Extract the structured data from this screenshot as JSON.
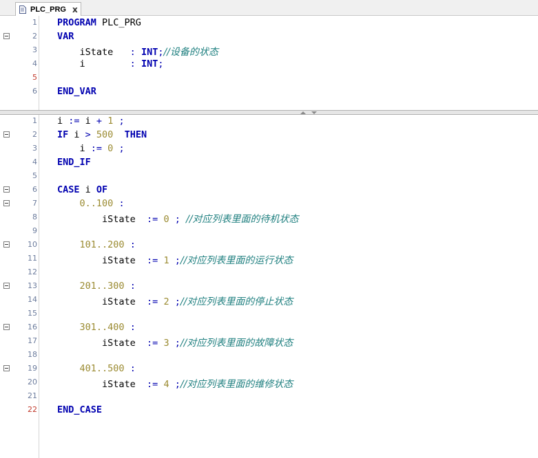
{
  "tab": {
    "title": "PLC_PRG",
    "close": "x",
    "icon": "document-icon"
  },
  "declaration": {
    "lines": [
      {
        "n": "1",
        "fold": false,
        "parts": [
          [
            "kw",
            "PROGRAM"
          ],
          [
            "t",
            " PLC_PRG"
          ]
        ]
      },
      {
        "n": "2",
        "fold": true,
        "parts": [
          [
            "kw",
            "VAR"
          ]
        ]
      },
      {
        "n": "3",
        "fold": false,
        "parts": [
          [
            "t",
            "    iState   "
          ],
          [
            "op",
            ": "
          ],
          [
            "kw",
            "INT"
          ],
          [
            "op",
            ";"
          ],
          [
            "cmt",
            "//设备的状态"
          ]
        ]
      },
      {
        "n": "4",
        "fold": false,
        "parts": [
          [
            "t",
            "    i        "
          ],
          [
            "op",
            ": "
          ],
          [
            "kw",
            "INT"
          ],
          [
            "op",
            ";"
          ]
        ]
      },
      {
        "n": "5",
        "fold": false,
        "err": true,
        "parts": []
      },
      {
        "n": "6",
        "fold": false,
        "parts": [
          [
            "kw",
            "END_VAR"
          ]
        ]
      }
    ]
  },
  "implementation": {
    "lines": [
      {
        "n": "1",
        "fold": false,
        "parts": [
          [
            "t",
            "i "
          ],
          [
            "op",
            ":= "
          ],
          [
            "t",
            "i "
          ],
          [
            "op",
            "+ "
          ],
          [
            "num",
            "1"
          ],
          [
            "t",
            " "
          ],
          [
            "op",
            ";"
          ]
        ]
      },
      {
        "n": "2",
        "fold": true,
        "parts": [
          [
            "kw",
            "IF"
          ],
          [
            "t",
            " i "
          ],
          [
            "op",
            "> "
          ],
          [
            "num",
            "500"
          ],
          [
            "t",
            "  "
          ],
          [
            "kw",
            "THEN"
          ]
        ]
      },
      {
        "n": "3",
        "fold": false,
        "parts": [
          [
            "t",
            "    i "
          ],
          [
            "op",
            ":= "
          ],
          [
            "num",
            "0"
          ],
          [
            "t",
            " "
          ],
          [
            "op",
            ";"
          ]
        ]
      },
      {
        "n": "4",
        "fold": false,
        "parts": [
          [
            "kw",
            "END_IF"
          ]
        ]
      },
      {
        "n": "5",
        "fold": false,
        "parts": []
      },
      {
        "n": "6",
        "fold": true,
        "parts": [
          [
            "kw",
            "CASE"
          ],
          [
            "t",
            " i "
          ],
          [
            "kw",
            "OF"
          ]
        ]
      },
      {
        "n": "7",
        "fold": true,
        "parts": [
          [
            "t",
            "    "
          ],
          [
            "num",
            "0..100"
          ],
          [
            "t",
            " "
          ],
          [
            "op",
            ":"
          ]
        ]
      },
      {
        "n": "8",
        "fold": false,
        "parts": [
          [
            "t",
            "        iState  "
          ],
          [
            "op",
            ":= "
          ],
          [
            "num",
            "0"
          ],
          [
            "t",
            " "
          ],
          [
            "op",
            "; "
          ],
          [
            "cmt",
            "//对应列表里面的待机状态"
          ]
        ]
      },
      {
        "n": "9",
        "fold": false,
        "parts": []
      },
      {
        "n": "10",
        "fold": true,
        "parts": [
          [
            "t",
            "    "
          ],
          [
            "num",
            "101..200"
          ],
          [
            "t",
            " "
          ],
          [
            "op",
            ":"
          ]
        ]
      },
      {
        "n": "11",
        "fold": false,
        "parts": [
          [
            "t",
            "        iState  "
          ],
          [
            "op",
            ":= "
          ],
          [
            "num",
            "1"
          ],
          [
            "t",
            " "
          ],
          [
            "op",
            ";"
          ],
          [
            "cmt",
            "//对应列表里面的运行状态"
          ]
        ]
      },
      {
        "n": "12",
        "fold": false,
        "parts": []
      },
      {
        "n": "13",
        "fold": true,
        "parts": [
          [
            "t",
            "    "
          ],
          [
            "num",
            "201..300"
          ],
          [
            "t",
            " "
          ],
          [
            "op",
            ":"
          ]
        ]
      },
      {
        "n": "14",
        "fold": false,
        "parts": [
          [
            "t",
            "        iState  "
          ],
          [
            "op",
            ":= "
          ],
          [
            "num",
            "2"
          ],
          [
            "t",
            " "
          ],
          [
            "op",
            ";"
          ],
          [
            "cmt",
            "//对应列表里面的停止状态"
          ]
        ]
      },
      {
        "n": "15",
        "fold": false,
        "parts": []
      },
      {
        "n": "16",
        "fold": true,
        "parts": [
          [
            "t",
            "    "
          ],
          [
            "num",
            "301..400"
          ],
          [
            "t",
            " "
          ],
          [
            "op",
            ":"
          ]
        ]
      },
      {
        "n": "17",
        "fold": false,
        "parts": [
          [
            "t",
            "        iState  "
          ],
          [
            "op",
            ":= "
          ],
          [
            "num",
            "3"
          ],
          [
            "t",
            " "
          ],
          [
            "op",
            ";"
          ],
          [
            "cmt",
            "//对应列表里面的故障状态"
          ]
        ]
      },
      {
        "n": "18",
        "fold": false,
        "parts": []
      },
      {
        "n": "19",
        "fold": true,
        "parts": [
          [
            "t",
            "    "
          ],
          [
            "num",
            "401..500"
          ],
          [
            "t",
            " "
          ],
          [
            "op",
            ":"
          ]
        ]
      },
      {
        "n": "20",
        "fold": false,
        "parts": [
          [
            "t",
            "        iState  "
          ],
          [
            "op",
            ":= "
          ],
          [
            "num",
            "4"
          ],
          [
            "t",
            " "
          ],
          [
            "op",
            ";"
          ],
          [
            "cmt",
            "//对应列表里面的维修状态"
          ]
        ]
      },
      {
        "n": "21",
        "fold": false,
        "parts": []
      },
      {
        "n": "22",
        "fold": false,
        "err": true,
        "parts": [
          [
            "kw",
            "END_CASE"
          ]
        ]
      }
    ]
  },
  "colors": {
    "keyword": "#0000b0",
    "number": "#9a8a30",
    "comment": "#208080",
    "line_number": "#6b7b9c",
    "error_line_number": "#c0392b"
  }
}
